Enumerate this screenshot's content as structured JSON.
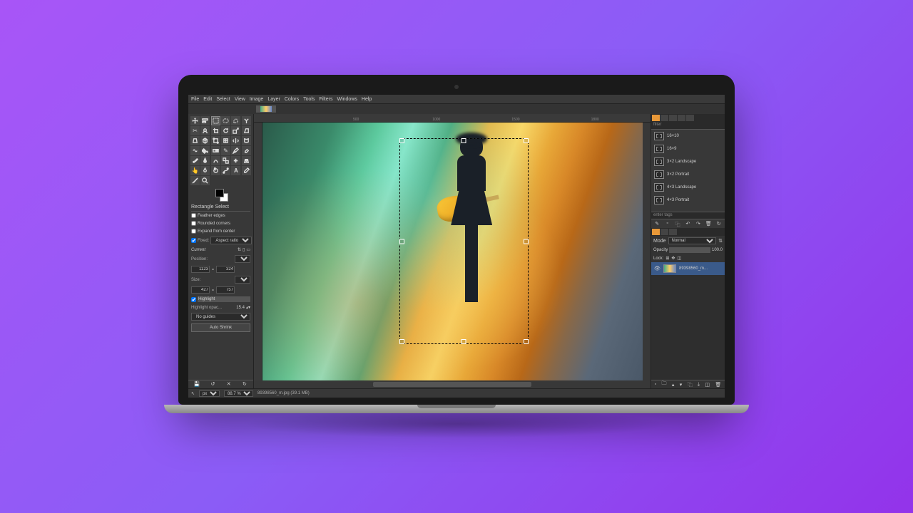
{
  "menubar": [
    "File",
    "Edit",
    "Select",
    "View",
    "Image",
    "Layer",
    "Colors",
    "Tools",
    "Filters",
    "Windows",
    "Help"
  ],
  "tool_options": {
    "title": "Rectangle Select",
    "feather": "Feather edges",
    "rounded": "Rounded corners",
    "expand": "Expand from center",
    "fixed_label": "Fixed:",
    "fixed_value": "Aspect ratio",
    "current": "Current",
    "position_label": "Position:",
    "position_unit": "px",
    "pos_x": "1123",
    "pos_y": "324",
    "size_label": "Size:",
    "size_unit": "px",
    "size_w": "427",
    "size_h": "757",
    "highlight": "Highlight",
    "highlight_opac_label": "Highlight opac...",
    "highlight_opac_val": "15.4",
    "guides": "No guides",
    "auto_shrink": "Auto Shrink"
  },
  "ruler_marks": [
    "500",
    "1000",
    "1500",
    "1800"
  ],
  "rp": {
    "search": "filter",
    "presets": [
      "16×10",
      "16×9",
      "3×2 Landscape",
      "3×2 Portrait",
      "4×3 Landscape",
      "4×3 Portrait"
    ],
    "enter_tags": "enter tags",
    "mode_label": "Mode",
    "mode_value": "Normal",
    "opacity_label": "Opacity",
    "opacity_value": "100.0",
    "lock_label": "Lock:",
    "layer_name": "89398560_m..."
  },
  "status": {
    "unit": "px",
    "zoom": "88.7 %",
    "file": "89398560_m.jpg (39.1 MB)"
  }
}
